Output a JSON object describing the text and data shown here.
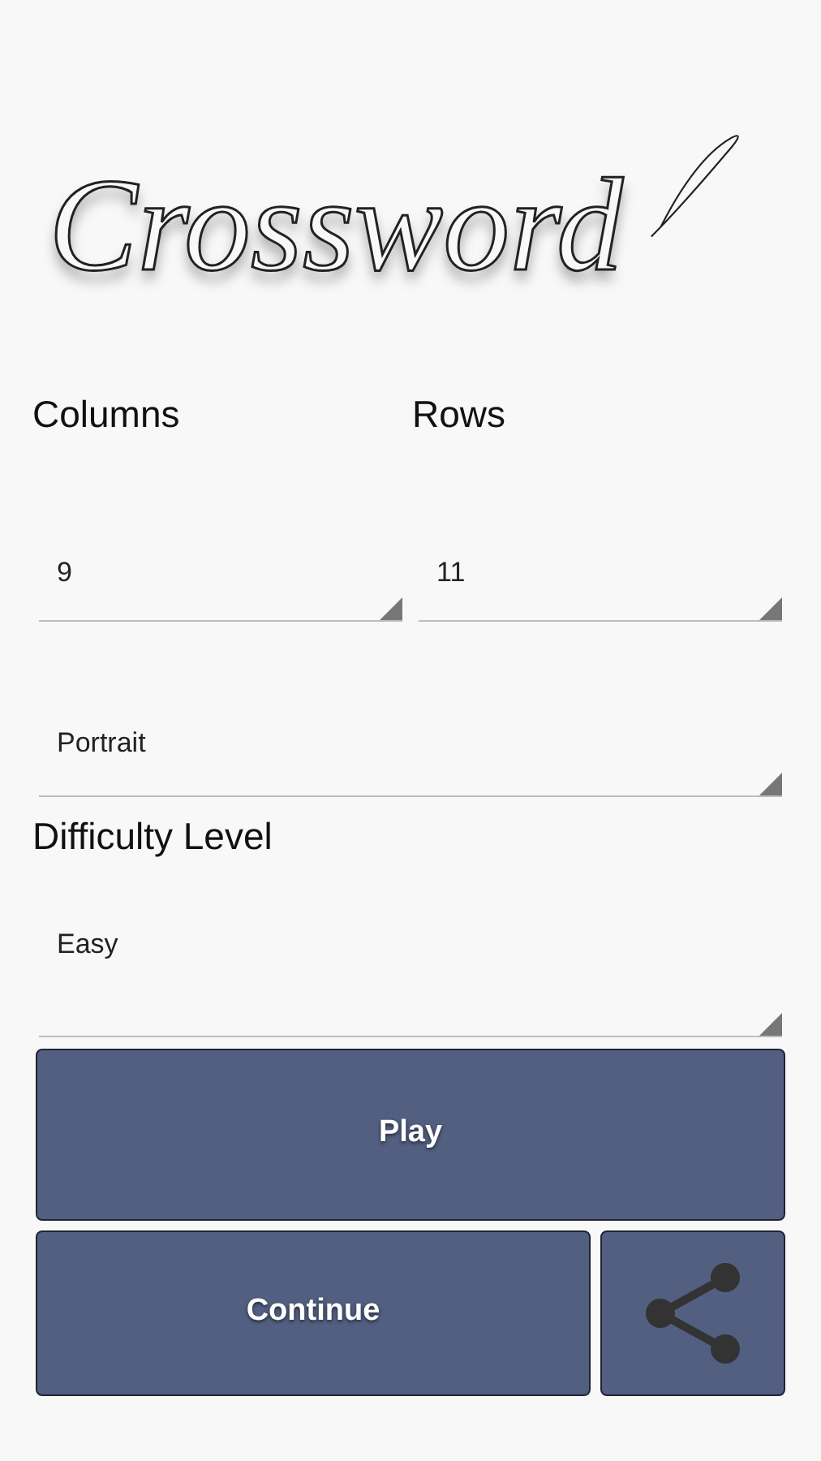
{
  "logo": {
    "title": "Crossword"
  },
  "size": {
    "columns_label": "Columns",
    "rows_label": "Rows",
    "columns_value": "9",
    "rows_value": "11"
  },
  "orientation": {
    "value": "Portrait"
  },
  "difficulty": {
    "label": "Difficulty Level",
    "value": "Easy"
  },
  "buttons": {
    "play": "Play",
    "continue": "Continue"
  }
}
